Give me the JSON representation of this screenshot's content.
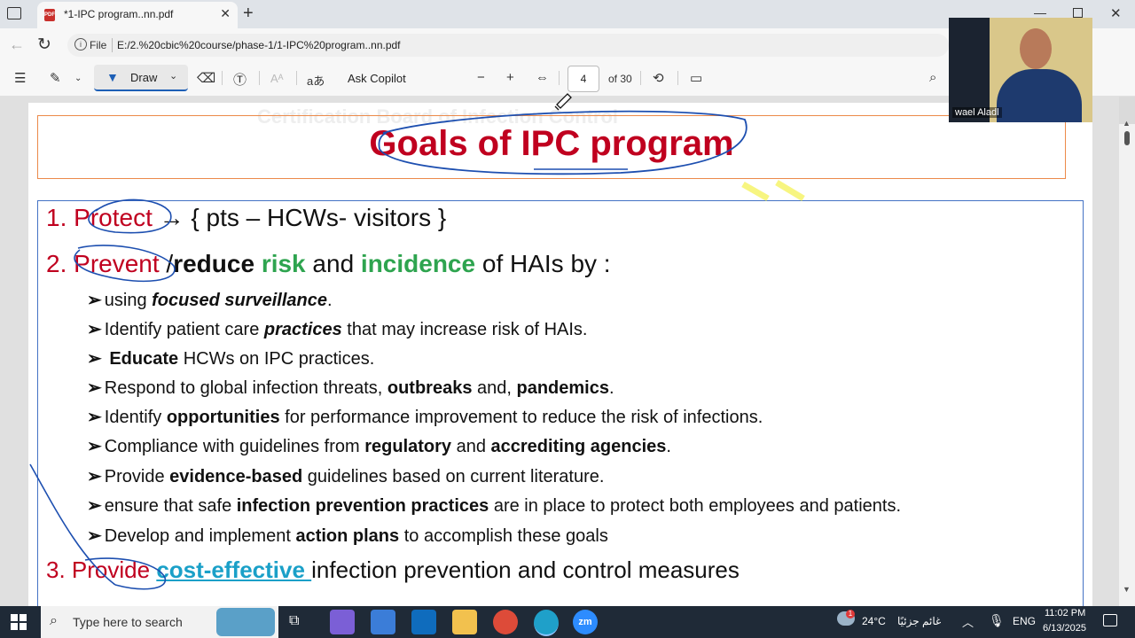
{
  "tab": {
    "title": "*1-IPC program..nn.pdf",
    "close": "✕"
  },
  "address": {
    "file_label": "File",
    "path": "E:/2.%20cbic%20course/phase-1/1-IPC%20program..nn.pdf"
  },
  "toolbar": {
    "draw_label": "Draw",
    "ask_copilot": "Ask Copilot",
    "read_aloud": "aあ",
    "zoom_out": "−",
    "zoom_in": "+",
    "page_current": "4",
    "page_total": "of 30"
  },
  "webcam": {
    "participant_name": "wael Aladl"
  },
  "document": {
    "ghost_text": "Certification Board of Infection Control",
    "title": "Goals of IPC program",
    "item1": {
      "num": "1.",
      "keyword": "Protect",
      "rest": " → { pts – HCWs-  visitors }"
    },
    "item2": {
      "num": "2.",
      "keyword": "Prevent",
      "sep": " /",
      "reduce": "reduce",
      "risk": "risk",
      "and": " and ",
      "incidence": "incidence",
      "rest": " of  HAIs by :"
    },
    "bullets": [
      {
        "pre": "using ",
        "bold": "focused surveillance",
        "post": "."
      },
      {
        "pre": "Identify patient care ",
        "bold": "practices",
        "post": " that may increase risk of HAIs."
      },
      {
        "pre": " ",
        "bold": "Educate",
        "post": "  HCWs on IPC practices."
      },
      {
        "pre": "Respond to global infection threats, ",
        "bold": "outbreaks",
        "post": " and, ",
        "bold2": "pandemics",
        "post2": "."
      },
      {
        "pre": "Identify ",
        "bold": "opportunities",
        "post": " for performance improvement to reduce the risk of infections."
      },
      {
        "pre": "Compliance with guidelines from ",
        "bold": "regulatory",
        "post": " and ",
        "bold2": "accrediting agencies",
        "post2": "."
      },
      {
        "pre": "Provide ",
        "bold": "evidence-based",
        "post": " guidelines based on current literature."
      },
      {
        "pre": "ensure that safe ",
        "bold": "infection prevention practices",
        "post": " are in place to protect both employees and patients."
      },
      {
        "pre": "Develop and implement ",
        "bold": "action plans",
        "post": " to accomplish these goals"
      }
    ],
    "item3": {
      "num": "3.",
      "keyword": "Provide",
      "highlight": "cost-effective ",
      "rest": "infection prevention and control measures"
    }
  },
  "taskbar": {
    "search_placeholder": "Type here to search",
    "weather_temp": "24°C",
    "weather_text": "غائم جزئيًا",
    "language": "ENG",
    "time": "11:02 PM",
    "date": "6/13/2025",
    "notification_count": "1"
  },
  "colors": {
    "title_red": "#c0001f",
    "green": "#2ea44f",
    "teal": "#1aa0c8",
    "ink_blue": "#1d4fb0",
    "accent": "#1d5fb6"
  }
}
